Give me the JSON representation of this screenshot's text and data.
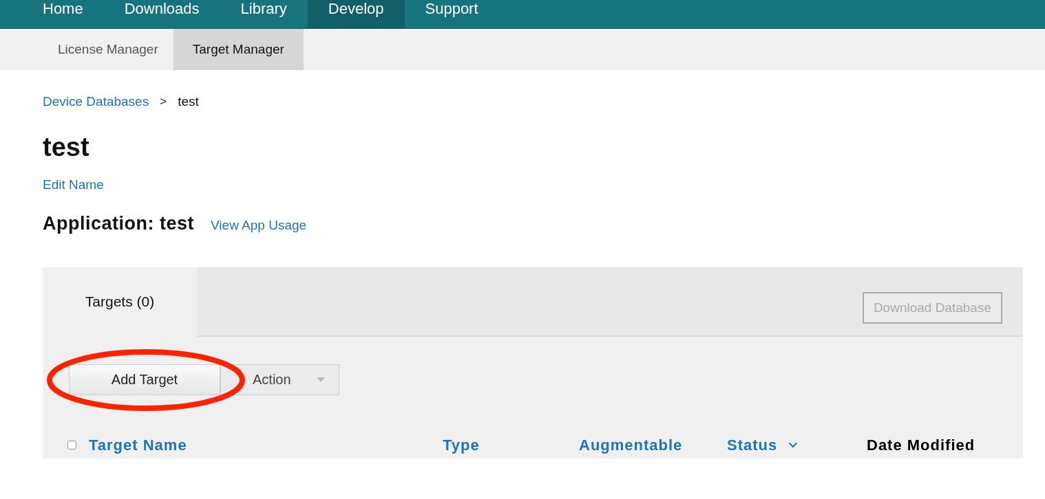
{
  "nav": [
    {
      "label": "Home",
      "selected": false
    },
    {
      "label": "Downloads",
      "selected": false
    },
    {
      "label": "Library",
      "selected": false
    },
    {
      "label": "Develop",
      "selected": true
    },
    {
      "label": "Support",
      "selected": false
    }
  ],
  "subnav": [
    {
      "label": "License Manager",
      "selected": false
    },
    {
      "label": "Target Manager",
      "selected": true
    }
  ],
  "breadcrumb": {
    "link": "Device Databases",
    "separator": ">",
    "current": "test"
  },
  "title": "test",
  "edit_link": "Edit Name",
  "application": {
    "heading": "Application: test",
    "link": "View App Usage"
  },
  "panel": {
    "tabs": [
      {
        "label": "Targets (0)",
        "selected": true
      }
    ],
    "download_button": {
      "label": "Download Database",
      "disabled": true
    },
    "toolbar": [
      {
        "kind": "button",
        "label": "Add Target",
        "circled": true
      },
      {
        "kind": "dropdown",
        "label": "Action",
        "circled": false
      }
    ],
    "select_all_checked": false,
    "columns": [
      {
        "label": "Target Name",
        "link": true,
        "sorted": false
      },
      {
        "label": "Type",
        "link": true,
        "sorted": false
      },
      {
        "label": "Augmentable",
        "link": true,
        "sorted": false
      },
      {
        "label": "Status",
        "link": true,
        "sorted": true
      },
      {
        "label": "Date Modified",
        "link": false,
        "sorted": false
      }
    ]
  }
}
